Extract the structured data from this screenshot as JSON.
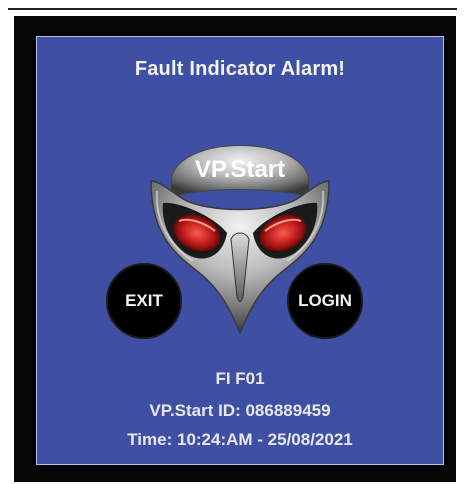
{
  "alarm": {
    "title": "Fault Indicator Alarm!",
    "logo_text": "VP.Start",
    "exit_label": "EXIT",
    "login_label": "LOGIN",
    "fi_code": "FI F01",
    "device_id": "VP.Start ID: 086889459",
    "time": "Time: 10:24:AM - 25/08/2021"
  },
  "colors": {
    "panel_background": "#3e4fa4",
    "frame": "#050505",
    "button": "#000000",
    "eye_red": "#c81e1e"
  },
  "icons": {
    "logo": "owl-mask-logo-icon"
  }
}
